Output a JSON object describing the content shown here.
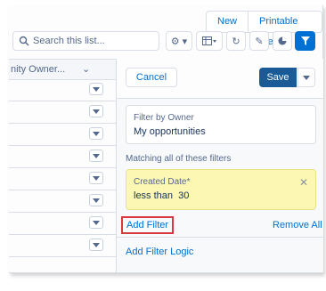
{
  "toolbar": {
    "new_label": "New",
    "printable_label": "Printable View",
    "search_placeholder": "Search this list...",
    "icons": [
      "gear-icon",
      "table-icon",
      "refresh-icon",
      "pencil-icon",
      "chart-icon",
      "filter-icon"
    ]
  },
  "table": {
    "column_header": "nity Owner..."
  },
  "filter_panel": {
    "cancel_label": "Cancel",
    "save_label": "Save",
    "owner_filter": {
      "label": "Filter by Owner",
      "value": "My opportunities"
    },
    "matching_text": "Matching all of these filters",
    "filters": [
      {
        "field": "Created Date*",
        "condition": "less than  30"
      }
    ],
    "add_filter_label": "Add Filter",
    "remove_all_label": "Remove All",
    "add_logic_label": "Add Filter Logic"
  },
  "colors": {
    "link": "#0070d2",
    "save_button": "#1a5a96",
    "filter_active": "#0070d2",
    "highlight_card": "#fcf8b3",
    "callout_box": "#d9383e"
  }
}
